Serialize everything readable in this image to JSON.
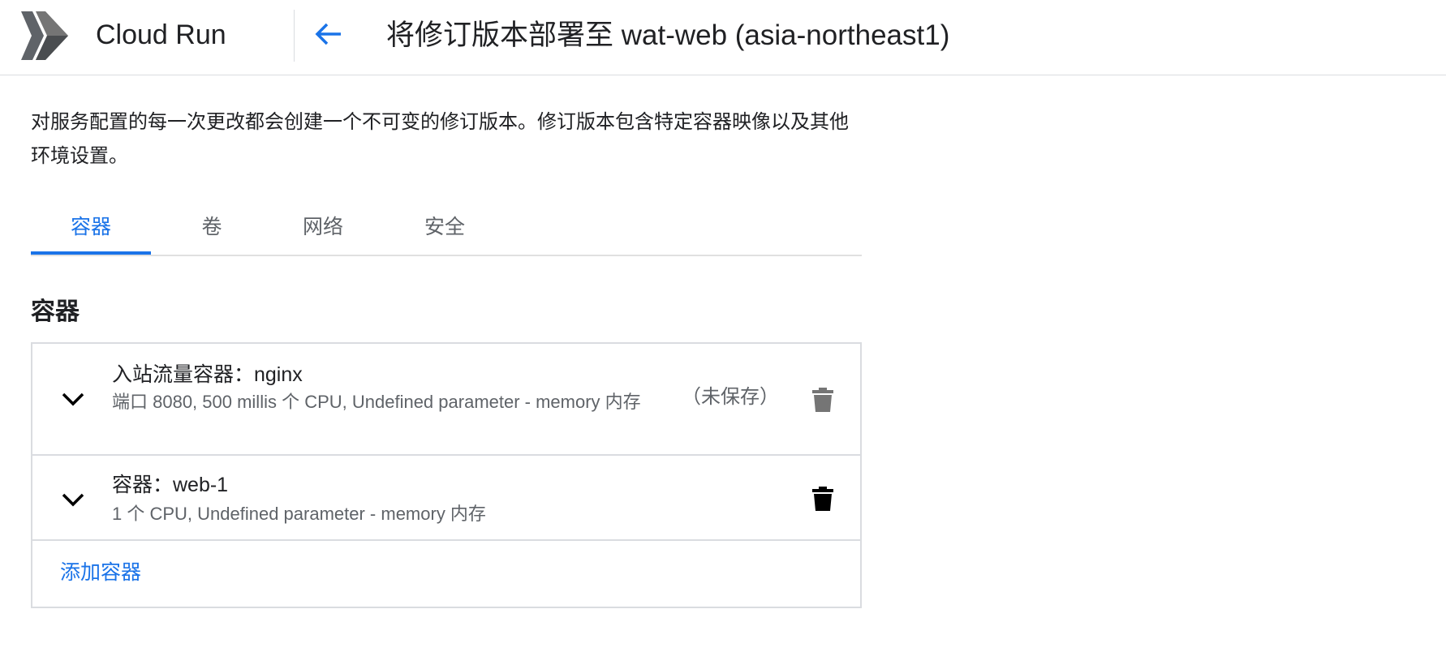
{
  "header": {
    "product_name": "Cloud Run",
    "logo_icon": "cloud-run-logo",
    "back_icon": "arrow-back-icon",
    "title": "将修订版本部署至 wat-web (asia-northeast1)"
  },
  "description": "对服务配置的每一次更改都会创建一个不可变的修订版本。修订版本包含特定容器映像以及其他环境设置。",
  "tabs": [
    {
      "label": "容器",
      "active": true
    },
    {
      "label": "卷",
      "active": false
    },
    {
      "label": "网络",
      "active": false
    },
    {
      "label": "安全",
      "active": false
    }
  ],
  "section": {
    "heading": "容器",
    "containers": [
      {
        "title": "入站流量容器：nginx",
        "subtitle": "端口 8080, 500 millis 个 CPU, Undefined parameter - memory 内存",
        "status": "（未保存）",
        "delete_icon": "trash-icon"
      },
      {
        "title": "容器：web-1",
        "subtitle": "1 个 CPU, Undefined parameter - memory 内存",
        "status": "",
        "delete_icon": "trash-icon"
      }
    ],
    "add_label": "添加容器"
  },
  "colors": {
    "accent": "#1a73e8",
    "text": "#202124",
    "secondary_text": "#5f6368",
    "border": "#dadce0",
    "icon_gray": "#757575",
    "icon_dark": "#000000"
  }
}
